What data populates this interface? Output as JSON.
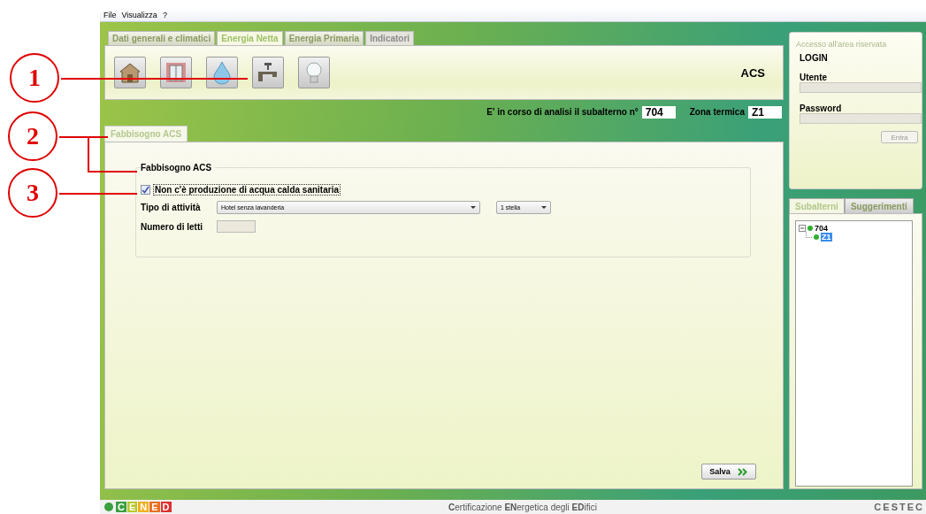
{
  "menu": [
    "File",
    "Visualizza",
    "?"
  ],
  "main_tabs": [
    {
      "label": "Dati generali e climatici",
      "selected": false,
      "disabled": false
    },
    {
      "label": "Energia Netta",
      "selected": true,
      "disabled": false
    },
    {
      "label": "Energia Primaria",
      "selected": false,
      "disabled": false
    },
    {
      "label": "Indicatori",
      "selected": false,
      "disabled": true
    }
  ],
  "toolbar": {
    "title": "ACS",
    "icons": [
      {
        "kind": "house"
      },
      {
        "kind": "window"
      },
      {
        "kind": "drop"
      },
      {
        "kind": "tap"
      },
      {
        "kind": "bulb"
      }
    ]
  },
  "info": {
    "subalterno_label": "E' in corso di analisi il subalterno n°",
    "subalterno_value": "704",
    "zona_label": "Zona termica",
    "zona_value": "Z1"
  },
  "sub_tabs": [
    {
      "label": "Fabbisogno ACS",
      "selected": true
    }
  ],
  "group": {
    "title": "Fabbisogno ACS",
    "checkbox": {
      "label": "Non c'è produzione di acqua calda sanitaria",
      "checked": true
    },
    "tipo_label": "Tipo di attività",
    "tipo_value": "Hotel senza lavanderia",
    "stelle_value": "1 stella",
    "letti_label": "Numero di letti",
    "letti_disabled": true
  },
  "save_button": "Salva",
  "login": {
    "heading": "Accesso all'area riservata",
    "title": "LOGIN",
    "user_label": "Utente",
    "password_label": "Password",
    "fields_disabled": true,
    "button": "Entra"
  },
  "side_tabs": [
    {
      "label": "Subalterni",
      "selected": true
    },
    {
      "label": "Suggerimenti",
      "selected": false
    }
  ],
  "tree": [
    {
      "label": "704",
      "expanded": true,
      "children": [
        {
          "label": "Z1",
          "selected": true
        }
      ]
    }
  ],
  "footer": {
    "logo_letters": [
      {
        "letter": "C",
        "color": "#3aa040"
      },
      {
        "letter": "E",
        "color": "#b8c82a"
      },
      {
        "letter": "N",
        "color": "#f0b020"
      },
      {
        "letter": "E",
        "color": "#e87020"
      },
      {
        "letter": "D",
        "color": "#e03030"
      }
    ],
    "caption": "**C**ertificazione **EN**ergetica degli **ED**ifici",
    "brand": "CESTEC"
  },
  "callouts": [
    {
      "number": "1"
    },
    {
      "number": "2"
    },
    {
      "number": "3"
    }
  ]
}
